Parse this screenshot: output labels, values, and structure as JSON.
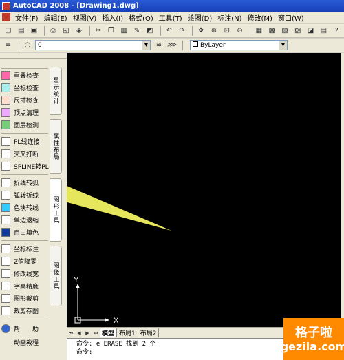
{
  "window": {
    "title": "AutoCAD 2008 - [Drawing1.dwg]"
  },
  "menu": [
    "文件(F)",
    "编辑(E)",
    "视图(V)",
    "插入(I)",
    "格式(O)",
    "工具(T)",
    "绘图(D)",
    "标注(N)",
    "修改(M)",
    "窗口(W)"
  ],
  "layer_toolbar": {
    "current_layer": "0",
    "color": "ByLayer"
  },
  "tool_panel": {
    "groups": [
      {
        "tab": "显示统计",
        "items": [
          {
            "label": "重叠检查",
            "icon": "overlap-icon"
          },
          {
            "label": "坐标检查",
            "icon": "coordinate-icon"
          },
          {
            "label": "尺寸检查",
            "icon": "dimension-icon"
          },
          {
            "label": "顶点清理",
            "icon": "vertex-icon"
          },
          {
            "label": "图层检测",
            "icon": "layer-icon"
          }
        ]
      },
      {
        "tab": "属性布局",
        "items": [
          {
            "label": "PL线连接",
            "icon": "pline-join-icon"
          },
          {
            "label": "交叉打断",
            "icon": "break-icon"
          },
          {
            "label": "SPLINE转PL",
            "icon": "spline-icon"
          }
        ]
      },
      {
        "tab": "图形工具",
        "items": [
          {
            "label": "折线转弧",
            "icon": "line-to-arc-icon"
          },
          {
            "label": "弧转折线",
            "icon": "arc-to-line-icon"
          },
          {
            "label": "色块转线",
            "icon": "color-block-icon"
          },
          {
            "label": "单边退缩",
            "icon": "offset-icon"
          },
          {
            "label": "自由填色",
            "icon": "fill-icon"
          }
        ]
      },
      {
        "tab": "图像工具",
        "items": [
          {
            "label": "坐标标注",
            "icon": "coord-label-icon"
          },
          {
            "label": "Z值降零",
            "icon": "z-zero-icon"
          },
          {
            "label": "修改线宽",
            "icon": "linewidth-icon"
          },
          {
            "label": "字高精度",
            "icon": "text-height-icon"
          },
          {
            "label": "图形裁剪",
            "icon": "clip-icon"
          },
          {
            "label": "裁剪存图",
            "icon": "clip-save-icon"
          }
        ]
      }
    ],
    "help": [
      {
        "label": "帮　　助",
        "icon": "help-icon"
      },
      {
        "label": "动画教程",
        "icon": ""
      }
    ]
  },
  "ucs": {
    "x_label": "X",
    "y_label": "Y"
  },
  "layout_tabs": [
    "模型",
    "布局1",
    "布局2"
  ],
  "command_line": [
    "命令: e ERASE 找到 2 个",
    "命令:"
  ],
  "watermark": {
    "line1": "格子啦",
    "line2": "gezila.com"
  },
  "colors": {
    "canvas": "#000000",
    "pointer": "#ffff66",
    "titlebar": "#1f4fc9"
  }
}
